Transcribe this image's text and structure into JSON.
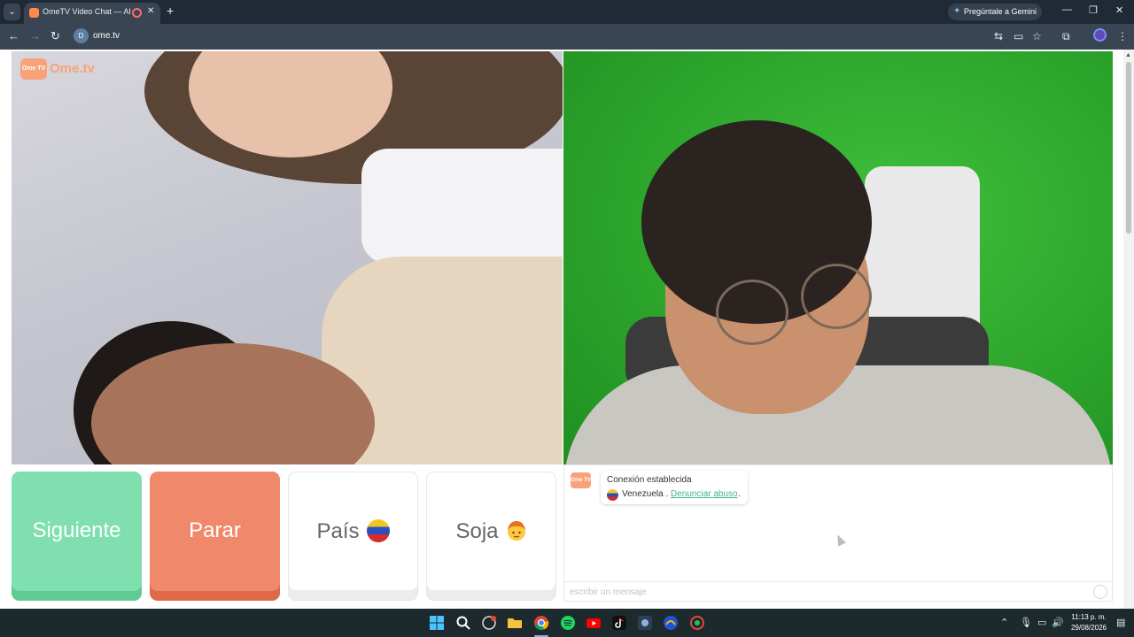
{
  "browser": {
    "tab_title": "OmeTV Video Chat — Alter",
    "gemini_label": "Pregúntale a Gemini",
    "url": "ome.tv",
    "site_badge": "D"
  },
  "app": {
    "logo_badge": "Ome TV",
    "logo_text": "Ome.tv",
    "buttons": {
      "next_label": "Siguiente",
      "stop_label": "Parar",
      "country_label": "País",
      "gender_label": "Soja"
    },
    "chat": {
      "logo": "Ome TV",
      "status": "Conexión establecida",
      "country": "Venezuela .",
      "report_link": "Denunciar abuso",
      "period": ".",
      "input_placeholder": "escribir un mensaje"
    }
  },
  "colors": {
    "next": "#7fdfae",
    "stop": "#f0896b",
    "brand": "#f9a27a",
    "link": "#3fb58a"
  },
  "taskbar": {
    "time": "11:13 p. m.",
    "date": "29/08/2026",
    "apps": [
      "windows-start-icon",
      "search-icon",
      "copilot-icon",
      "file-explorer-icon",
      "chrome-icon",
      "spotify-icon",
      "youtube-icon",
      "tiktok-icon",
      "app-icon",
      "music-app-icon",
      "recorder-icon"
    ]
  }
}
